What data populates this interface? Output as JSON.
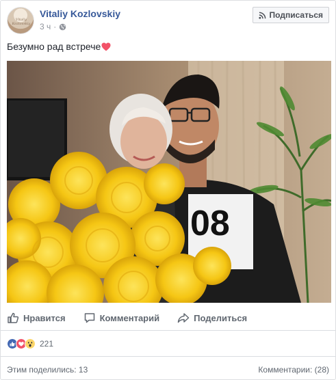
{
  "post": {
    "author": "Vitaliy Kozlovskiy",
    "avatar_text": "Vitaliy Kozlovskiy",
    "time": "3 ч",
    "separator": "·",
    "privacy_icon": "globe-icon",
    "subscribe_label": "Подписаться",
    "text": "Безумно рад встрече"
  },
  "actions": {
    "like_label": "Нравится",
    "comment_label": "Комментарий",
    "share_label": "Поделиться"
  },
  "reactions": {
    "types": [
      "like",
      "love",
      "wow"
    ],
    "count": "221"
  },
  "footer": {
    "shares": "Этим поделились: 13",
    "comments": "Комментарии: (28)"
  },
  "colors": {
    "link": "#365899",
    "like_blue": "#4267b2",
    "love_red": "#f25268",
    "wow_yellow": "#fcd669",
    "flowers_yellow": "#f7cf1c"
  }
}
